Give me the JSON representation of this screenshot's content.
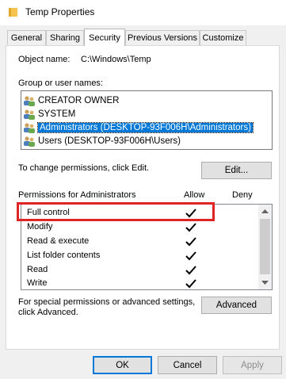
{
  "window": {
    "title": "Temp Properties"
  },
  "tabs": [
    {
      "label": "General"
    },
    {
      "label": "Sharing"
    },
    {
      "label": "Security"
    },
    {
      "label": "Previous Versions"
    },
    {
      "label": "Customize"
    }
  ],
  "object": {
    "label": "Object name:",
    "value": "C:\\Windows\\Temp"
  },
  "groups": {
    "label": "Group or user names:",
    "items": [
      {
        "name": "CREATOR OWNER"
      },
      {
        "name": "SYSTEM"
      },
      {
        "name": "Administrators (DESKTOP-93F006H\\Administrators)"
      },
      {
        "name": "Users (DESKTOP-93F006H\\Users)"
      }
    ],
    "selected_index": 2
  },
  "change_permissions": {
    "text": "To change permissions, click Edit.",
    "button": "Edit..."
  },
  "permissions": {
    "header": "Permissions for Administrators",
    "allow_label": "Allow",
    "deny_label": "Deny",
    "rows": [
      {
        "name": "Full control",
        "allow": true,
        "deny": false
      },
      {
        "name": "Modify",
        "allow": true,
        "deny": false
      },
      {
        "name": "Read & execute",
        "allow": true,
        "deny": false
      },
      {
        "name": "List folder contents",
        "allow": true,
        "deny": false
      },
      {
        "name": "Read",
        "allow": true,
        "deny": false
      },
      {
        "name": "Write",
        "allow": true,
        "deny": false
      }
    ]
  },
  "advanced": {
    "text_line1": "For special permissions or advanced settings,",
    "text_line2": "click Advanced.",
    "button": "Advanced"
  },
  "footer": {
    "ok": "OK",
    "cancel": "Cancel",
    "apply": "Apply"
  },
  "colors": {
    "selection": "#0078d7",
    "highlight_box": "#e02424",
    "folder": "#f5c44f"
  }
}
